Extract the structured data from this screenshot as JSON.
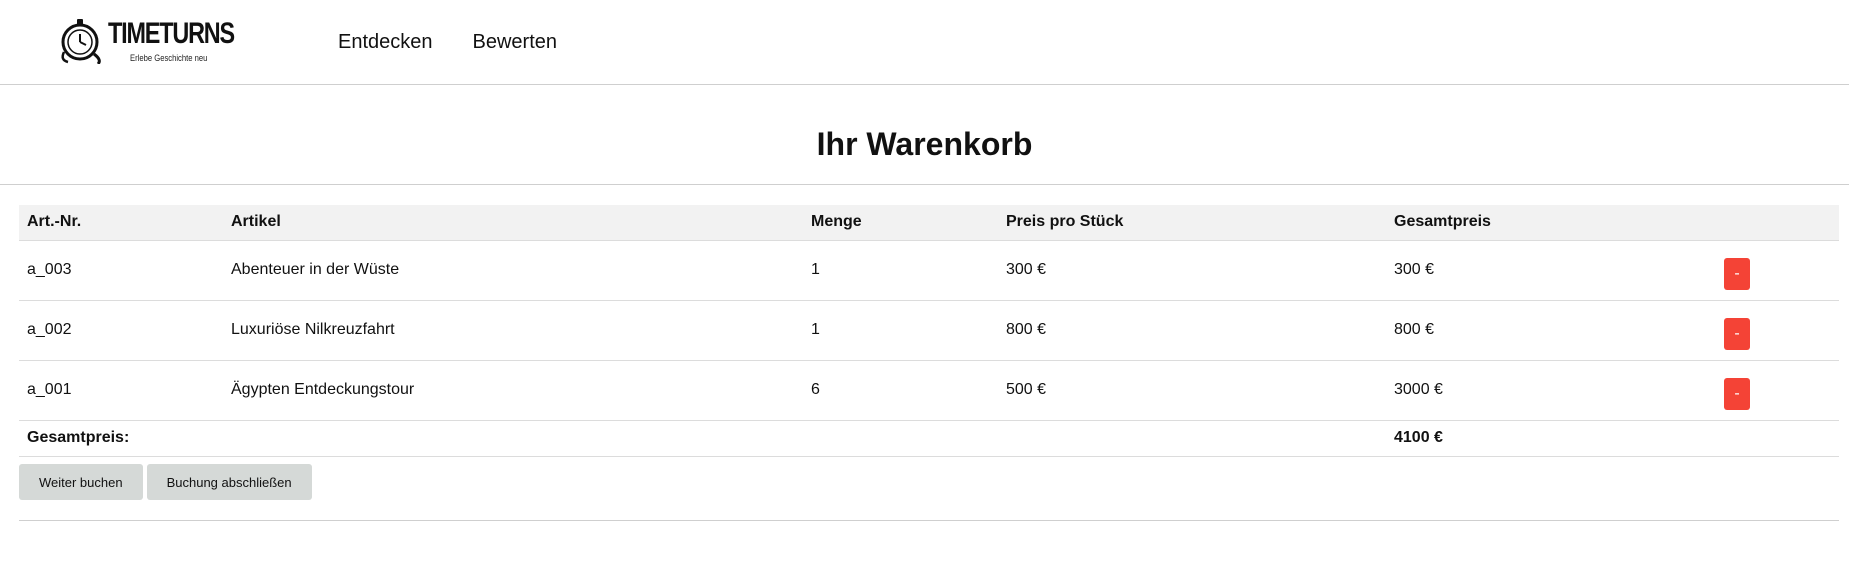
{
  "brand": {
    "name": "TIMETURNS",
    "tagline": "Erlebe Geschichte neu"
  },
  "nav": {
    "items": [
      {
        "label": "Entdecken"
      },
      {
        "label": "Bewerten"
      }
    ]
  },
  "page": {
    "title": "Ihr Warenkorb"
  },
  "cart": {
    "columns": [
      "Art.-Nr.",
      "Artikel",
      "Menge",
      "Preis pro Stück",
      "Gesamtpreis",
      ""
    ],
    "rows": [
      {
        "id": "a_003",
        "name": "Abenteuer in der Wüste",
        "qty": "1",
        "unit_price": "300 €",
        "total": "300 €",
        "remove_label": "-"
      },
      {
        "id": "a_002",
        "name": "Luxuriöse Nilkreuzfahrt",
        "qty": "1",
        "unit_price": "800 €",
        "total": "800 €",
        "remove_label": "-"
      },
      {
        "id": "a_001",
        "name": "Ägypten Entdeckungstour",
        "qty": "6",
        "unit_price": "500 €",
        "total": "3000 €",
        "remove_label": "-"
      }
    ],
    "total_label": "Gesamtpreis:",
    "total_value": "4100 €"
  },
  "actions": {
    "continue_label": "Weiter buchen",
    "checkout_label": "Buchung abschließen"
  },
  "colors": {
    "remove_button": "#f44336",
    "action_button": "#d5d9d7",
    "header_row": "#f2f2f2"
  }
}
